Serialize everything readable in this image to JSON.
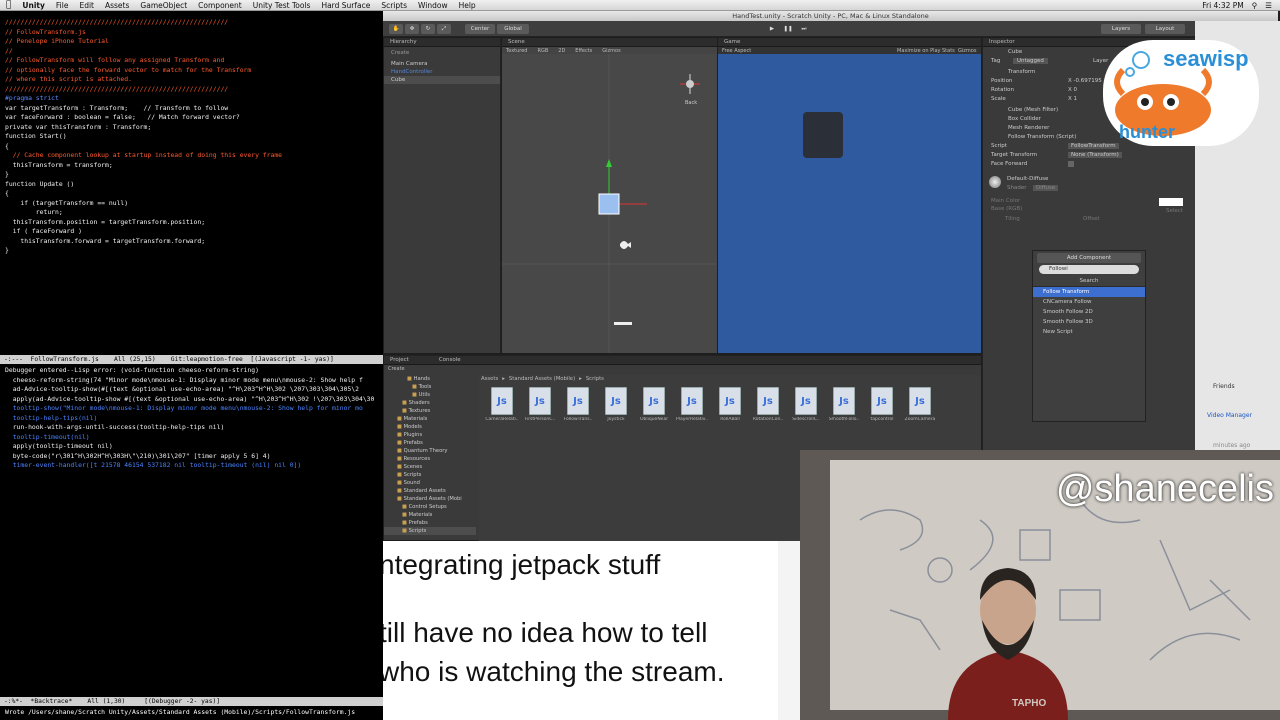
{
  "menubar": {
    "apple": "",
    "app": "Unity",
    "items": [
      "File",
      "Edit",
      "Assets",
      "GameObject",
      "Component",
      "Unity Test Tools",
      "Hard Surface",
      "Scripts",
      "Window",
      "Help"
    ],
    "right": [
      "Fri 4:32 PM"
    ]
  },
  "emacs": {
    "code": [
      {
        "c": "cm",
        "t": "//////////////////////////////////////////////////////////"
      },
      {
        "c": "cm",
        "t": "// FollowTransform.js"
      },
      {
        "c": "cm",
        "t": "// Penelope iPhone Tutorial"
      },
      {
        "c": "cm",
        "t": "//"
      },
      {
        "c": "cm",
        "t": "// FollowTransform will follow any assigned Transform and"
      },
      {
        "c": "cm",
        "t": "// optionally face the forward vector to match for the Transform"
      },
      {
        "c": "cm",
        "t": "// where this script is attached."
      },
      {
        "c": "cm",
        "t": "//////////////////////////////////////////////////////////"
      },
      {
        "c": "pl",
        "t": ""
      },
      {
        "c": "kw",
        "t": "#pragma strict"
      },
      {
        "c": "pl",
        "t": ""
      },
      {
        "c": "pl",
        "t": "var targetTransform : Transform;    // Transform to follow"
      },
      {
        "c": "pl",
        "t": "var faceForward : boolean = false;   // Match forward vector?"
      },
      {
        "c": "pl",
        "t": "private var thisTransform : Transform;"
      },
      {
        "c": "pl",
        "t": ""
      },
      {
        "c": "pl",
        "t": "function Start()"
      },
      {
        "c": "pl",
        "t": "{"
      },
      {
        "c": "cm",
        "t": "  // Cache component lookup at startup instead of doing this every frame"
      },
      {
        "c": "pl",
        "t": "  thisTransform = transform;"
      },
      {
        "c": "pl",
        "t": "}"
      },
      {
        "c": "pl",
        "t": ""
      },
      {
        "c": "pl",
        "t": "function Update ()"
      },
      {
        "c": "pl",
        "t": "{"
      },
      {
        "c": "pl",
        "t": "    if (targetTransform == null)"
      },
      {
        "c": "pl",
        "t": "        return;"
      },
      {
        "c": "pl",
        "t": "  thisTransform.position = targetTransform.position;"
      },
      {
        "c": "pl",
        "t": ""
      },
      {
        "c": "pl",
        "t": "  if ( faceForward )"
      },
      {
        "c": "pl",
        "t": "    thisTransform.forward = targetTransform.forward;"
      },
      {
        "c": "pl",
        "t": "}"
      }
    ],
    "modeline1": "-:---  FollowTransform.js    All (25,15)    Git:leapmotion-free  [(Javascript -1- yas)]",
    "debug": [
      {
        "c": "pl",
        "t": "Debugger entered--Lisp error: (void-function cheeso-reform-string)"
      },
      {
        "c": "pl",
        "t": "  cheeso-reform-string(74 \"Minor mode\\nmouse-1: Display minor mode menu\\nmouse-2: Show help f"
      },
      {
        "c": "pl",
        "t": "  ad-Advice-tooltip-show(#[(text &optional use-echo-area) \"^H\\203^H^H\\302 \\207\\303\\304\\305\\2"
      },
      {
        "c": "pl",
        "t": "  apply(ad-Advice-tooltip-show #[(text &optional use-echo-area) \"^H\\203^H^H\\302 !\\207\\303\\304\\30"
      },
      {
        "c": "lnk",
        "t": "  tooltip-show(\"Minor mode\\nmouse-1: Display minor mode menu\\nmouse-2: Show help for minor mo"
      },
      {
        "c": "lnk",
        "t": "  tooltip-help-tips(nil)"
      },
      {
        "c": "pl",
        "t": "  run-hook-with-args-until-success(tooltip-help-tips nil)"
      },
      {
        "c": "lnk",
        "t": "  tooltip-timeout(nil)"
      },
      {
        "c": "pl",
        "t": "  apply(tooltip-timeout nil)"
      },
      {
        "c": "pl",
        "t": "  byte-code(\"r\\301^H\\302H^H\\303H\\\"\\210)\\301\\207\" [timer apply 5 6] 4)"
      },
      {
        "c": "lnk",
        "t": "  timer-event-handler([t 21578 46154 537182 nil tooltip-timeout (nil) nil 0])"
      }
    ],
    "modeline2": "-:%*-  *Backtrace*    All (1,30)     [(Debugger -2- yas)]",
    "minibuf": "Wrote /Users/shane/Scratch Unity/Assets/Standard Assets (Mobile)/Scripts/FollowTransform.js"
  },
  "unity": {
    "title": "HandTest.unity - Scratch Unity - PC, Mac & Linux Standalone",
    "toolbar": {
      "center": "Center",
      "global": "Global",
      "layers": "Layers",
      "layout": "Layout"
    },
    "hierarchy": {
      "tab": "Hierarchy",
      "create": "Create",
      "items": [
        "Main Camera",
        "HandController",
        "Cube"
      ]
    },
    "scene": {
      "tab": "Scene",
      "mode": "Textured",
      "rgb": "RGB",
      "twod": "2D",
      "effects": "Effects",
      "gizmos": "Gizmos",
      "back": "Back"
    },
    "game": {
      "tab": "Game",
      "aspect": "Free Aspect",
      "maximize": "Maximize on Play",
      "stats": "Stats",
      "gizmos": "Gizmos"
    },
    "inspector": {
      "tab": "Inspector",
      "object": "Cube",
      "tag": "Tag",
      "tag_val": "Untagged",
      "layer": "Layer",
      "transform": "Transform",
      "position": "Position",
      "rotation": "Rotation",
      "scale": "Scale",
      "pos_x": "X  -0.697195",
      "rot_x": "X  0",
      "scale_x": "X  1",
      "mesh_filter": "Cube (Mesh Filter)",
      "box_collider": "Box Collider",
      "mesh_renderer": "Mesh Renderer",
      "follow": "Follow Transform (Script)",
      "script": "Script",
      "script_val": "FollowTransform",
      "target": "Target Transform",
      "target_val": "None (Transform)",
      "face": "Face Forward",
      "material": "Default-Diffuse",
      "shader": "Shader",
      "shader_val": "Diffuse",
      "main_color": "Main Color",
      "base": "Base (RGB)",
      "tiling": "Tiling",
      "offset": "Offset",
      "select": "Select"
    },
    "addcomp": {
      "button": "Add Component",
      "search_value": "Followi",
      "search_header": "Search",
      "items": [
        "Follow Transform",
        "CNCamera Follow",
        "Smooth Follow 2D",
        "Smooth Follow 3D",
        "New Script"
      ]
    },
    "project": {
      "tab": "Project",
      "console": "Console",
      "create": "Create",
      "path": [
        "Assets",
        "Standard Assets (Mobile)",
        "Scripts"
      ],
      "tree": [
        "Hands",
        "Tools",
        "Utils",
        "Shaders",
        "Textures",
        "Materials",
        "Models",
        "Plugins",
        "Prefabs",
        "Quantum Theory",
        "Resources",
        "Scenes",
        "Scripts",
        "Sound",
        "Standard Assets",
        "Standard Assets (Mobi",
        "Control Setups",
        "Materials",
        "Prefabs",
        "Scripts"
      ],
      "files": [
        "CameraRelati..",
        "FirstPersonC..",
        "FollowTrans..",
        "Joystick",
        "ObliqueNear",
        "PlayerRelativ..",
        "RollABall",
        "RotationCon..",
        "SidescrollC..",
        "SmoothFollo..",
        "tapcontrol",
        "ZoomCamera"
      ]
    }
  },
  "rightpane": {
    "lines": [
      "Friends",
      "Video Manager",
      "minutes ago"
    ]
  },
  "logo": {
    "line1": "seawisp",
    "line2": "hunter"
  },
  "caption": {
    "lines": [
      "ntegrating jetpack stuff",
      "",
      "till have no idea how to tell",
      "who is watching the stream."
    ]
  },
  "webcam": {
    "handle": "@shanecelis",
    "shirt": "TAPHO"
  },
  "colors": {
    "unity_bg": "#3a3a3a",
    "game_bg": "#2f5aa0",
    "selection": "#3d6fd0",
    "comment": "#ff5a2e",
    "keyword": "#5b8cff"
  }
}
